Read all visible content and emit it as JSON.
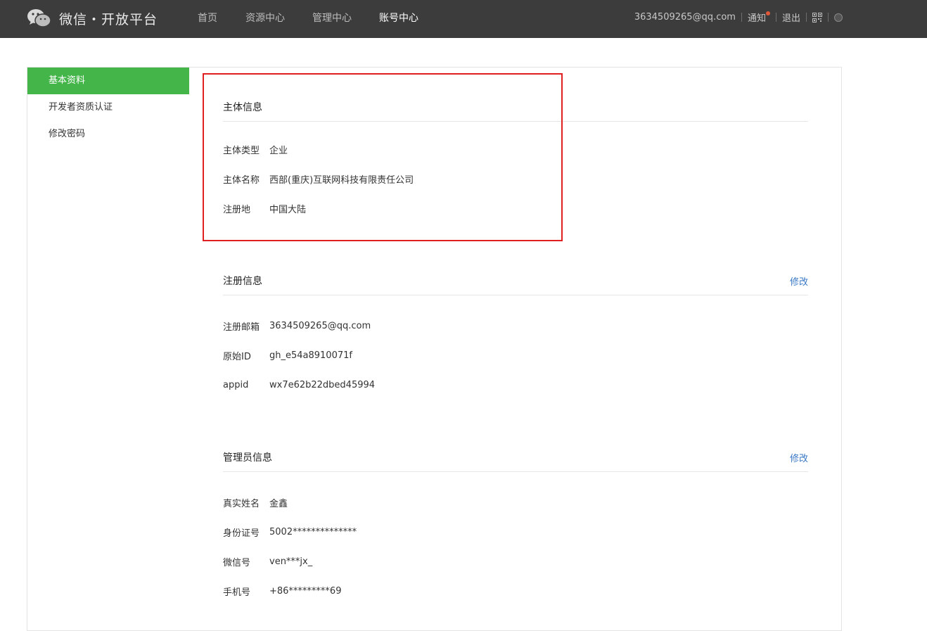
{
  "header": {
    "brand": "微信・开放平台",
    "nav": [
      {
        "label": "首页"
      },
      {
        "label": "资源中心"
      },
      {
        "label": "管理中心"
      },
      {
        "label": "账号中心"
      }
    ],
    "active_nav": "账号中心",
    "email": "3634509265@qq.com",
    "notice_label": "通知",
    "logout_label": "退出",
    "notice_dot_color": "#e0583a"
  },
  "sidebar": {
    "items": [
      {
        "label": "基本资料"
      },
      {
        "label": "开发者资质认证"
      },
      {
        "label": "修改密码"
      }
    ],
    "active_item": "基本资料",
    "active_color": "#44b549"
  },
  "sections": {
    "entity": {
      "title": "主体信息",
      "rows": [
        {
          "label": "主体类型",
          "value": "企业"
        },
        {
          "label": "主体名称",
          "value": "西部(重庆)互联网科技有限责任公司"
        },
        {
          "label": "注册地",
          "value": "中国大陆"
        }
      ]
    },
    "registration": {
      "title": "注册信息",
      "edit_label": "修改",
      "rows": [
        {
          "label": "注册邮箱",
          "value": "3634509265@qq.com"
        },
        {
          "label": "原始ID",
          "value": "gh_e54a8910071f"
        },
        {
          "label": "appid",
          "value": "wx7e62b22dbed45994"
        }
      ]
    },
    "admin": {
      "title": "管理员信息",
      "edit_label": "修改",
      "rows": [
        {
          "label": "真实姓名",
          "value": "金鑫"
        },
        {
          "label": "身份证号",
          "value": "5002**************"
        },
        {
          "label": "微信号",
          "value": "ven***jx_"
        },
        {
          "label": "手机号",
          "value": "+86*********69"
        }
      ]
    }
  },
  "annotation_color": "#e02020",
  "link_color": "#3a79c6"
}
